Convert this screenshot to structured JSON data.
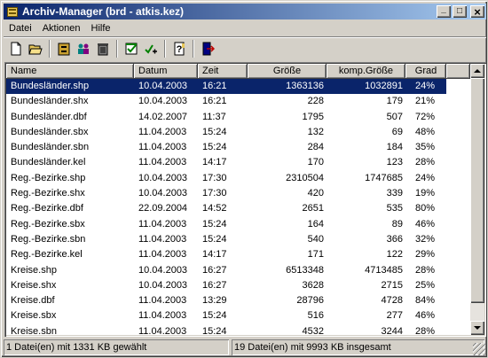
{
  "window": {
    "title": "Archiv-Manager  (brd - atkis.kez)",
    "controls": {
      "minimize": "_",
      "maximize": "□",
      "close": "×"
    }
  },
  "menu": {
    "items": [
      "Datei",
      "Aktionen",
      "Hilfe"
    ]
  },
  "toolbar": {
    "buttons": [
      "new-file",
      "open-folder",
      "archive",
      "extract",
      "delete",
      "check",
      "test",
      "help",
      "exit"
    ]
  },
  "list": {
    "columns": [
      "Name",
      "Datum",
      "Zeit",
      "Größe",
      "komp.Größe",
      "Grad"
    ],
    "rows": [
      {
        "name": "Bundesländer.shp",
        "datum": "10.04.2003",
        "zeit": "16:21",
        "groesse": "1363136",
        "komp": "1032891",
        "grad": "24%",
        "selected": true
      },
      {
        "name": "Bundesländer.shx",
        "datum": "10.04.2003",
        "zeit": "16:21",
        "groesse": "228",
        "komp": "179",
        "grad": "21%"
      },
      {
        "name": "Bundesländer.dbf",
        "datum": "14.02.2007",
        "zeit": "11:37",
        "groesse": "1795",
        "komp": "507",
        "grad": "72%"
      },
      {
        "name": "Bundesländer.sbx",
        "datum": "11.04.2003",
        "zeit": "15:24",
        "groesse": "132",
        "komp": "69",
        "grad": "48%"
      },
      {
        "name": "Bundesländer.sbn",
        "datum": "11.04.2003",
        "zeit": "15:24",
        "groesse": "284",
        "komp": "184",
        "grad": "35%"
      },
      {
        "name": "Bundesländer.kel",
        "datum": "11.04.2003",
        "zeit": "14:17",
        "groesse": "170",
        "komp": "123",
        "grad": "28%"
      },
      {
        "name": "Reg.-Bezirke.shp",
        "datum": "10.04.2003",
        "zeit": "17:30",
        "groesse": "2310504",
        "komp": "1747685",
        "grad": "24%"
      },
      {
        "name": "Reg.-Bezirke.shx",
        "datum": "10.04.2003",
        "zeit": "17:30",
        "groesse": "420",
        "komp": "339",
        "grad": "19%"
      },
      {
        "name": "Reg.-Bezirke.dbf",
        "datum": "22.09.2004",
        "zeit": "14:52",
        "groesse": "2651",
        "komp": "535",
        "grad": "80%"
      },
      {
        "name": "Reg.-Bezirke.sbx",
        "datum": "11.04.2003",
        "zeit": "15:24",
        "groesse": "164",
        "komp": "89",
        "grad": "46%"
      },
      {
        "name": "Reg.-Bezirke.sbn",
        "datum": "11.04.2003",
        "zeit": "15:24",
        "groesse": "540",
        "komp": "366",
        "grad": "32%"
      },
      {
        "name": "Reg.-Bezirke.kel",
        "datum": "11.04.2003",
        "zeit": "14:17",
        "groesse": "171",
        "komp": "122",
        "grad": "29%"
      },
      {
        "name": "Kreise.shp",
        "datum": "10.04.2003",
        "zeit": "16:27",
        "groesse": "6513348",
        "komp": "4713485",
        "grad": "28%"
      },
      {
        "name": "Kreise.shx",
        "datum": "10.04.2003",
        "zeit": "16:27",
        "groesse": "3628",
        "komp": "2715",
        "grad": "25%"
      },
      {
        "name": "Kreise.dbf",
        "datum": "11.04.2003",
        "zeit": "13:29",
        "groesse": "28796",
        "komp": "4728",
        "grad": "84%"
      },
      {
        "name": "Kreise.sbx",
        "datum": "11.04.2003",
        "zeit": "15:24",
        "groesse": "516",
        "komp": "277",
        "grad": "46%"
      },
      {
        "name": "Kreise.sbn",
        "datum": "11.04.2003",
        "zeit": "15:24",
        "groesse": "4532",
        "komp": "3244",
        "grad": "28%"
      }
    ]
  },
  "status": {
    "left": "1 Datei(en) mit 1331 KB gewählt",
    "right": "19 Datei(en) mit 9993 KB insgesamt"
  },
  "colors": {
    "selection": "#0a246a",
    "titlebar_start": "#0a246a",
    "titlebar_end": "#a6caf0",
    "face": "#d4d0c8"
  }
}
